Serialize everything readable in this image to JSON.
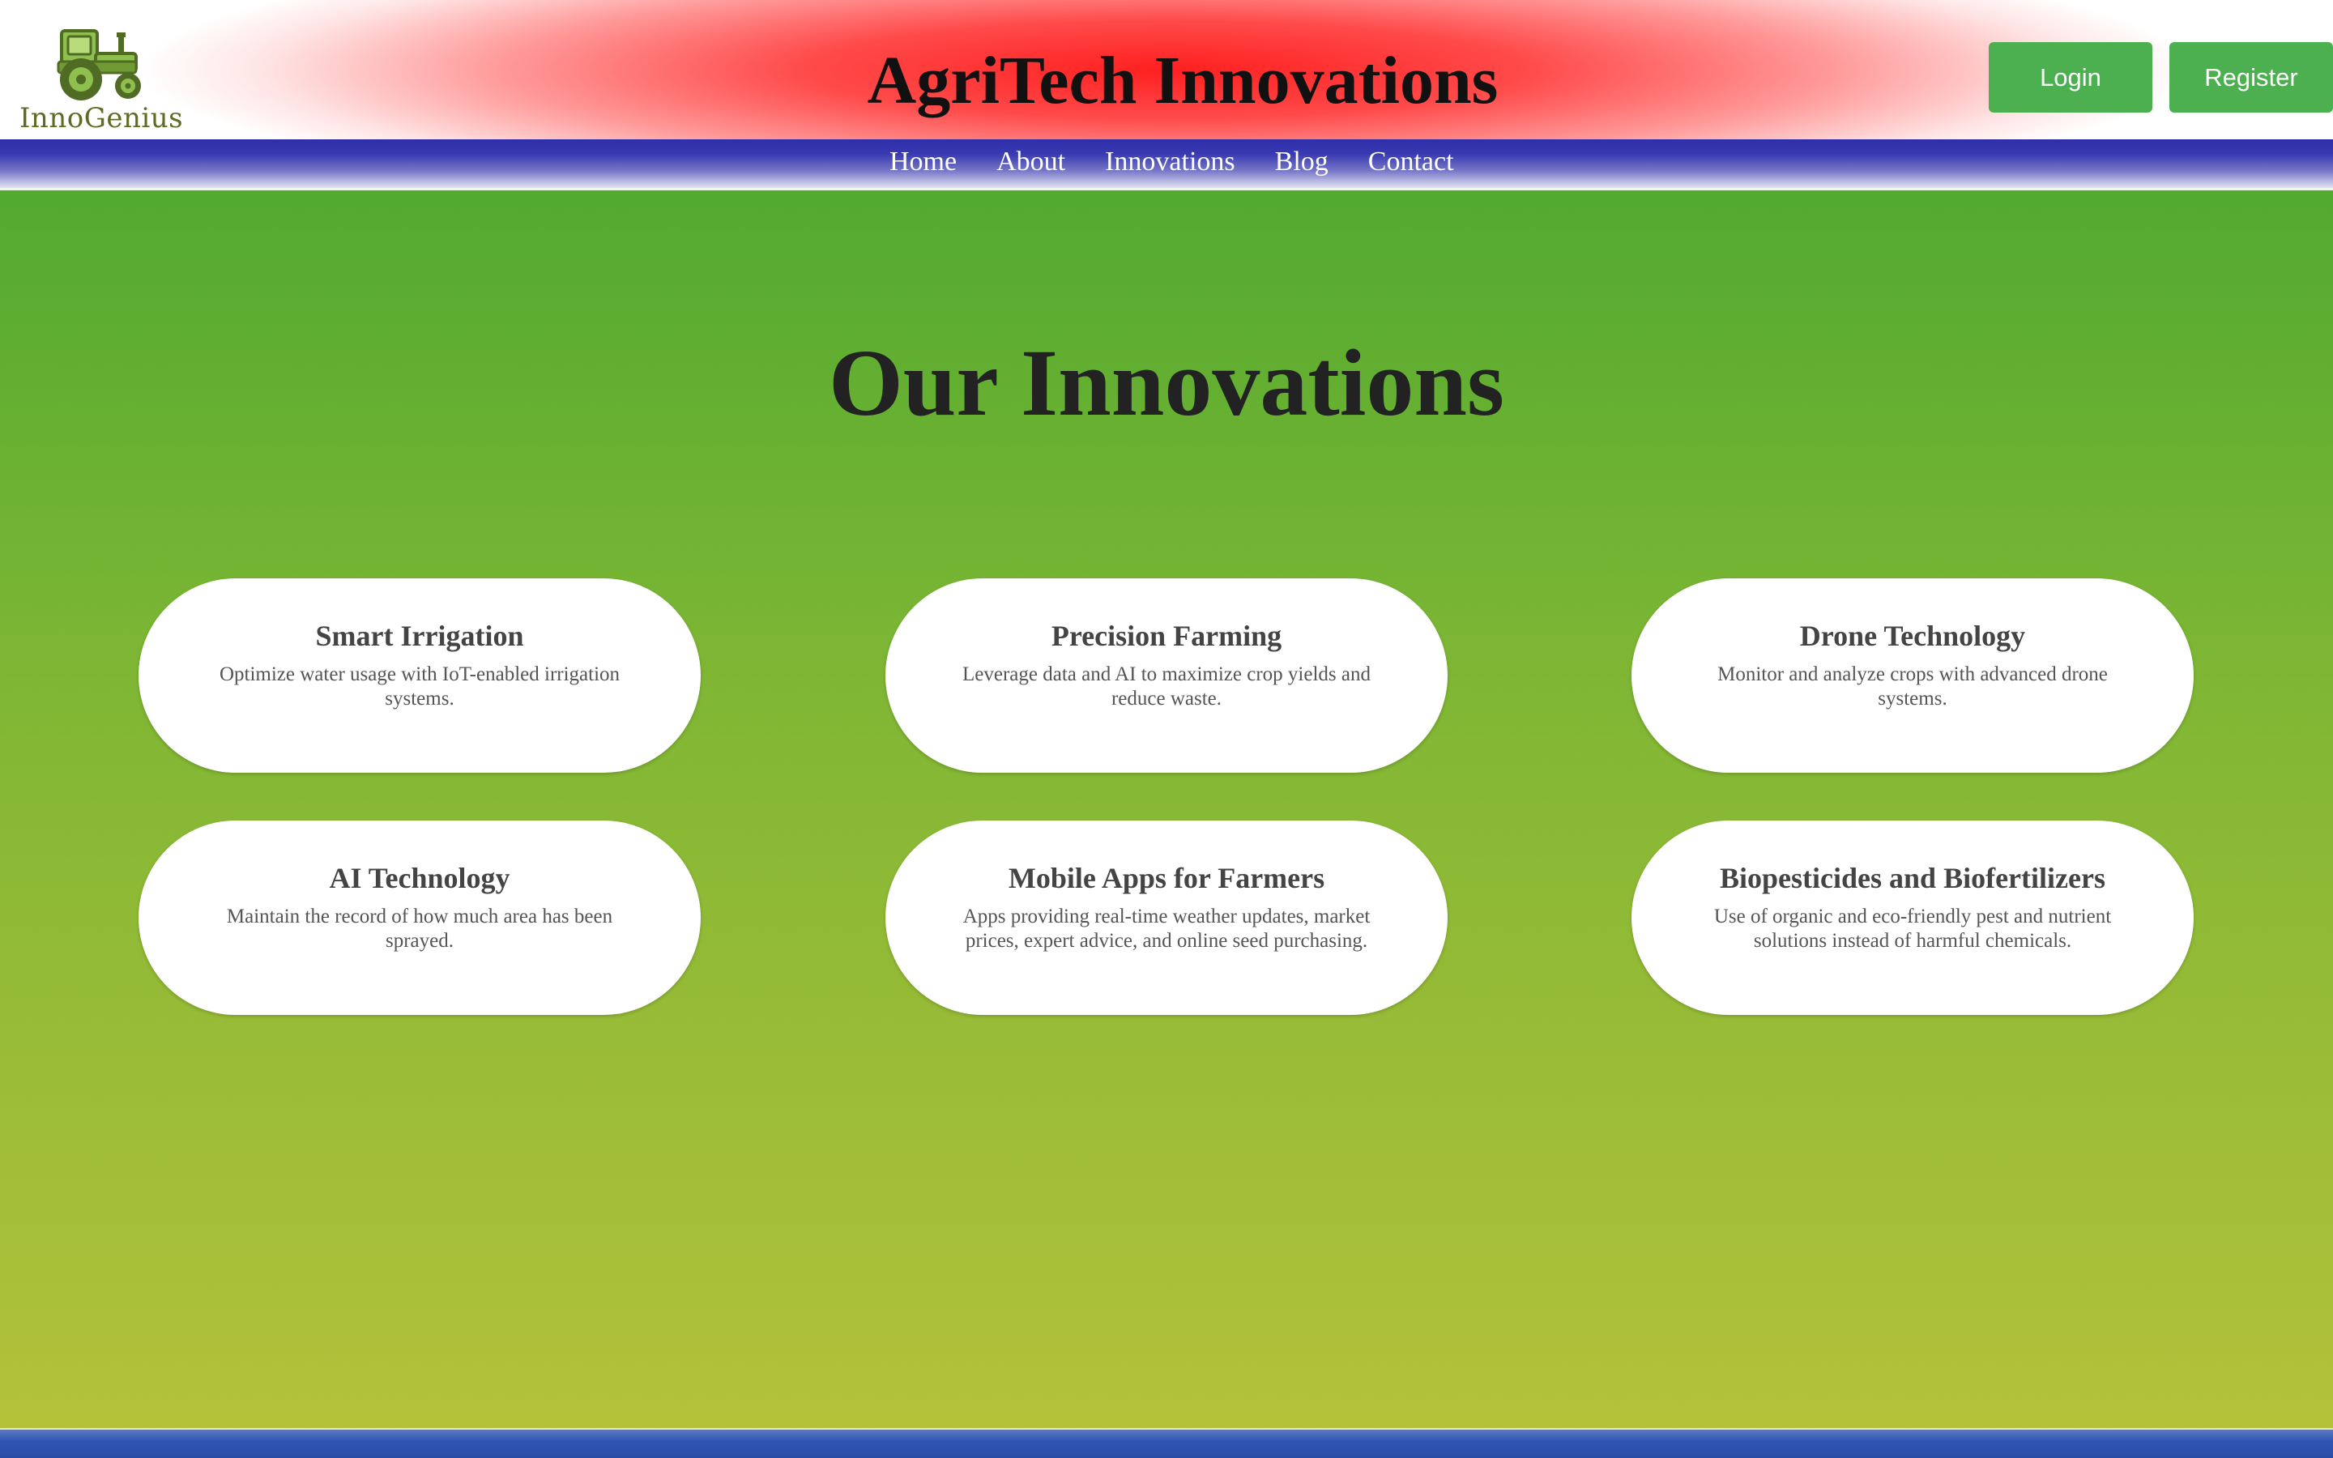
{
  "header": {
    "logo_text": "InnoGenius",
    "title": "AgriTech Innovations",
    "login_label": "Login",
    "register_label": "Register"
  },
  "nav": {
    "items": [
      {
        "label": "Home"
      },
      {
        "label": "About"
      },
      {
        "label": "Innovations"
      },
      {
        "label": "Blog"
      },
      {
        "label": "Contact"
      }
    ]
  },
  "section": {
    "title": "Our Innovations",
    "cards": [
      {
        "title": "Smart Irrigation",
        "description": "Optimize water usage with IoT-enabled irrigation systems."
      },
      {
        "title": "Precision Farming",
        "description": "Leverage data and AI to maximize crop yields and reduce waste."
      },
      {
        "title": "Drone Technology",
        "description": "Monitor and analyze crops with advanced drone systems."
      },
      {
        "title": "AI Technology",
        "description": "Maintain the record of how much area has been sprayed."
      },
      {
        "title": "Mobile Apps for Farmers",
        "description": "Apps providing real-time weather updates, market prices, expert advice, and online seed purchasing."
      },
      {
        "title": "Biopesticides and Biofertilizers",
        "description": "Use of organic and eco-friendly pest and nutrient solutions instead of harmful chemicals."
      }
    ]
  },
  "colors": {
    "button": "#4caf50",
    "header_accent": "#ff2020",
    "nav": "#3535b0",
    "page_top": "#40a52e",
    "page_bottom": "#b6c23a"
  },
  "icons": {
    "logo": "tractor-icon"
  }
}
